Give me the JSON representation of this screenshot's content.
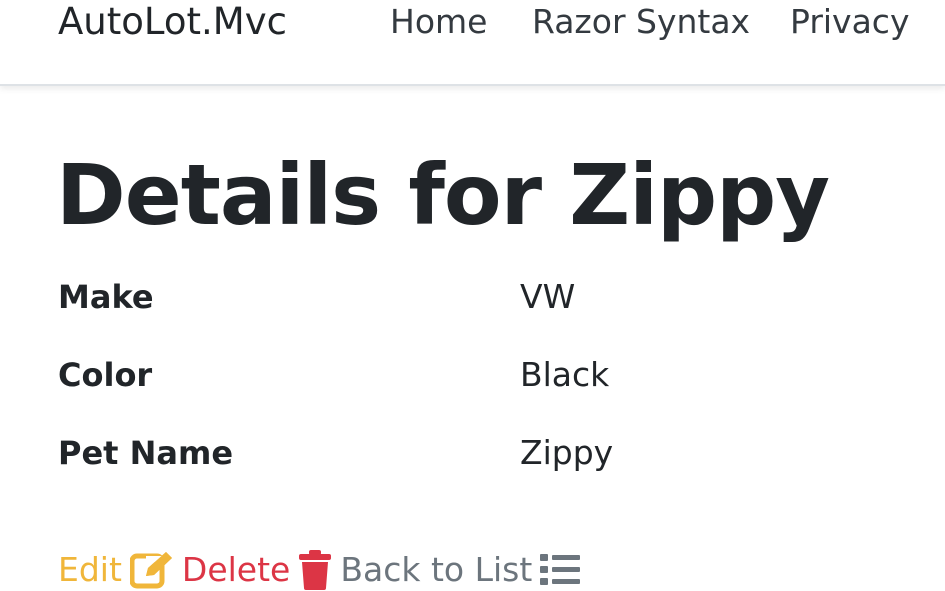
{
  "navbar": {
    "brand": "AutoLot.Mvc",
    "links": [
      {
        "label": "Home"
      },
      {
        "label": "Razor Syntax"
      },
      {
        "label": "Privacy"
      }
    ]
  },
  "main": {
    "title": "Details for Zippy",
    "fields": [
      {
        "label": "Make",
        "value": "VW"
      },
      {
        "label": "Color",
        "value": "Black"
      },
      {
        "label": "Pet Name",
        "value": "Zippy"
      }
    ],
    "actions": {
      "edit": {
        "label": "Edit",
        "icon": "edit-icon",
        "color": "#f0b63a"
      },
      "delete": {
        "label": "Delete",
        "icon": "trash-icon",
        "color": "#dc3545"
      },
      "back": {
        "label": "Back to List",
        "icon": "list-icon",
        "color": "#6c757d"
      }
    }
  }
}
